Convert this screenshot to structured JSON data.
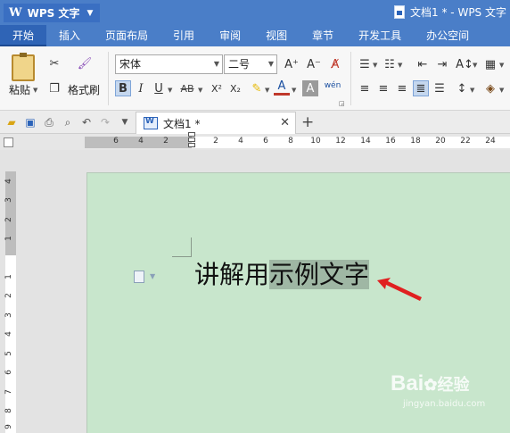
{
  "app": {
    "menu_logo": "W",
    "menu_label": "WPS 文字",
    "window_title": "文档1 * - WPS 文字"
  },
  "tabs": [
    "开始",
    "插入",
    "页面布局",
    "引用",
    "审阅",
    "视图",
    "章节",
    "开发工具",
    "办公空间"
  ],
  "active_tab": "开始",
  "ribbon": {
    "paste_label": "粘贴",
    "format_painter_label": "格式刷",
    "font_name": "宋体",
    "font_size": "二号",
    "bold": "B",
    "italic": "I",
    "underline": "U",
    "strikethrough": "AB",
    "superscript": "X²",
    "subscript": "X₂",
    "phonetic": "wén"
  },
  "document_tab": {
    "title": "文档1 *"
  },
  "ruler": {
    "left_numbers": [
      "6",
      "4",
      "2"
    ],
    "right_numbers": [
      "2",
      "4",
      "6",
      "8",
      "10",
      "12",
      "14",
      "16",
      "18",
      "20",
      "22",
      "24"
    ],
    "vertical_numbers": [
      "4",
      "3",
      "2",
      "1",
      "1",
      "2",
      "3",
      "4",
      "5",
      "6",
      "7",
      "8",
      "9"
    ]
  },
  "document": {
    "text_normal": "讲解用",
    "text_selected": "示例文字"
  },
  "watermark": {
    "brand": "Bai",
    "brand_cn": "经验",
    "url": "jingyan.baidu.com"
  },
  "colors": {
    "title_bar": "#4a7ec8",
    "page_background": "#c8e6cc",
    "selection": "#9fb7a4",
    "arrow": "#e02020"
  }
}
